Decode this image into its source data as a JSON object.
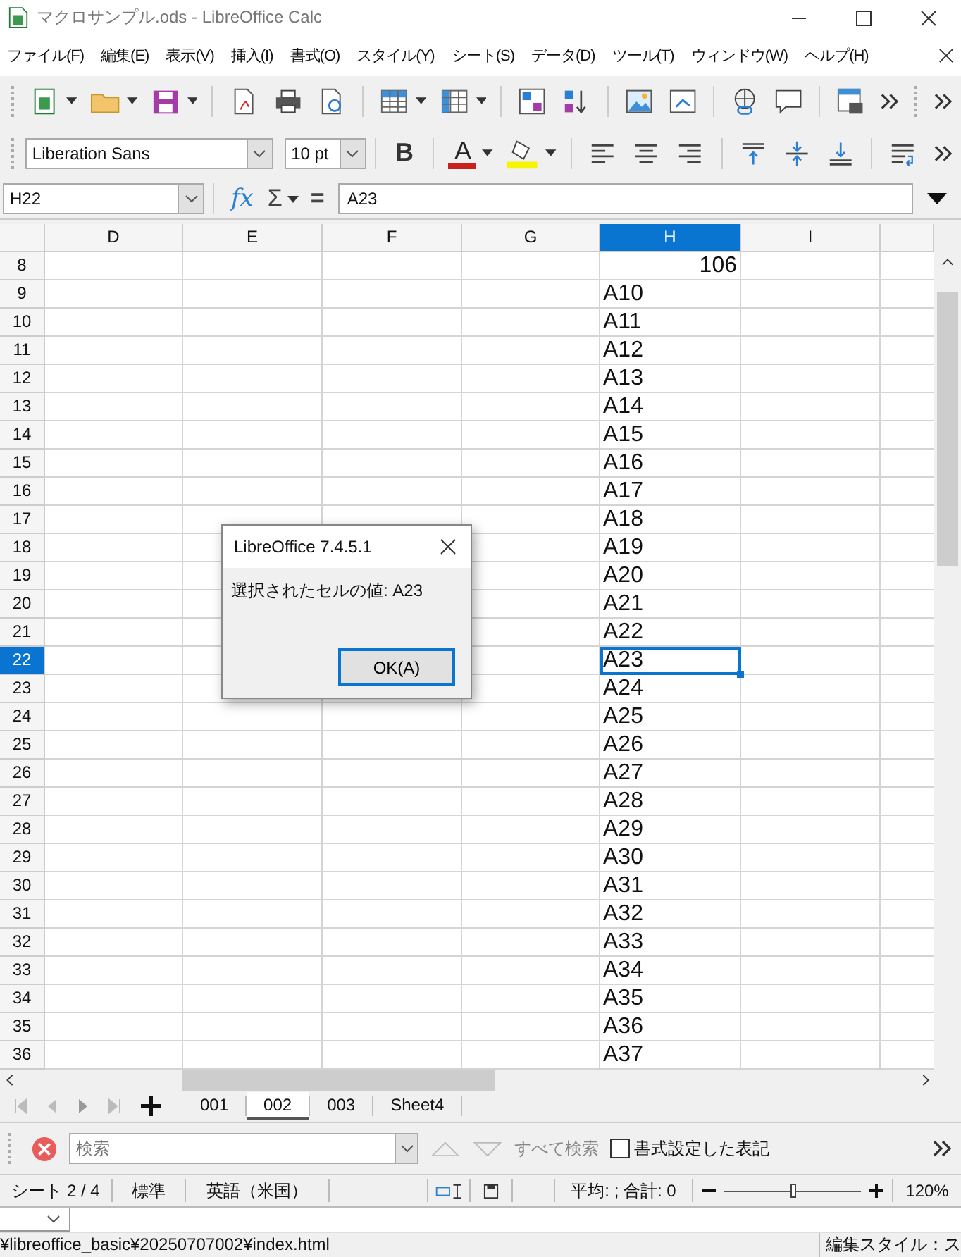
{
  "window": {
    "title": "マクロサンプル.ods - LibreOffice Calc"
  },
  "menu": [
    "ファイル(F)",
    "編集(E)",
    "表示(V)",
    "挿入(I)",
    "書式(O)",
    "スタイル(Y)",
    "シート(S)",
    "データ(D)",
    "ツール(T)",
    "ウィンドウ(W)",
    "ヘルプ(H)"
  ],
  "formatting": {
    "font_name": "Liberation Sans",
    "font_size": "10 pt",
    "bold_label": "B",
    "font_color_label": "A"
  },
  "formula_bar": {
    "name_box": "H22",
    "function_wizard": "fx",
    "sum": "Σ",
    "equals": "=",
    "formula": "A23"
  },
  "columns": [
    {
      "label": "D",
      "selected": false
    },
    {
      "label": "E",
      "selected": false
    },
    {
      "label": "F",
      "selected": false
    },
    {
      "label": "G",
      "selected": false
    },
    {
      "label": "H",
      "selected": true
    },
    {
      "label": "I",
      "selected": false
    }
  ],
  "rows": [
    {
      "number": "8",
      "selected": false,
      "kind": "number",
      "value": "106"
    },
    {
      "number": "9",
      "selected": false,
      "kind": "text",
      "value": "A10"
    },
    {
      "number": "10",
      "selected": false,
      "kind": "text",
      "value": "A11"
    },
    {
      "number": "11",
      "selected": false,
      "kind": "text",
      "value": "A12"
    },
    {
      "number": "12",
      "selected": false,
      "kind": "text",
      "value": "A13"
    },
    {
      "number": "13",
      "selected": false,
      "kind": "text",
      "value": "A14"
    },
    {
      "number": "14",
      "selected": false,
      "kind": "text",
      "value": "A15"
    },
    {
      "number": "15",
      "selected": false,
      "kind": "text",
      "value": "A16"
    },
    {
      "number": "16",
      "selected": false,
      "kind": "text",
      "value": "A17"
    },
    {
      "number": "17",
      "selected": false,
      "kind": "text",
      "value": "A18"
    },
    {
      "number": "18",
      "selected": false,
      "kind": "text",
      "value": "A19"
    },
    {
      "number": "19",
      "selected": false,
      "kind": "text",
      "value": "A20"
    },
    {
      "number": "20",
      "selected": false,
      "kind": "text",
      "value": "A21"
    },
    {
      "number": "21",
      "selected": false,
      "kind": "text",
      "value": "A22"
    },
    {
      "number": "22",
      "selected": true,
      "kind": "text",
      "value": "A23"
    },
    {
      "number": "23",
      "selected": false,
      "kind": "text",
      "value": "A24"
    },
    {
      "number": "24",
      "selected": false,
      "kind": "text",
      "value": "A25"
    },
    {
      "number": "25",
      "selected": false,
      "kind": "text",
      "value": "A26"
    },
    {
      "number": "26",
      "selected": false,
      "kind": "text",
      "value": "A27"
    },
    {
      "number": "27",
      "selected": false,
      "kind": "text",
      "value": "A28"
    },
    {
      "number": "28",
      "selected": false,
      "kind": "text",
      "value": "A29"
    },
    {
      "number": "29",
      "selected": false,
      "kind": "text",
      "value": "A30"
    },
    {
      "number": "30",
      "selected": false,
      "kind": "text",
      "value": "A31"
    },
    {
      "number": "31",
      "selected": false,
      "kind": "text",
      "value": "A32"
    },
    {
      "number": "32",
      "selected": false,
      "kind": "text",
      "value": "A33"
    },
    {
      "number": "33",
      "selected": false,
      "kind": "text",
      "value": "A34"
    },
    {
      "number": "34",
      "selected": false,
      "kind": "text",
      "value": "A35"
    },
    {
      "number": "35",
      "selected": false,
      "kind": "text",
      "value": "A36"
    },
    {
      "number": "36",
      "selected": false,
      "kind": "text",
      "value": "A37"
    }
  ],
  "dialog": {
    "title": "LibreOffice 7.4.5.1",
    "message": "選択されたセルの値: A23",
    "button": "OK(A)"
  },
  "sheet_tabs": [
    {
      "label": "001",
      "selected": false
    },
    {
      "label": "002",
      "selected": true
    },
    {
      "label": "003",
      "selected": false
    },
    {
      "label": "Sheet4",
      "selected": false
    }
  ],
  "find_bar": {
    "placeholder": "検索",
    "find_all": "すべて検索",
    "formatted_display": {
      "label": "書式設定した表記",
      "checked": false
    }
  },
  "status_bar": {
    "sheet": "シート 2 / 4",
    "page_style": "標準",
    "language": "英語（米国）",
    "summary": "平均: ; 合計: 0",
    "zoom_slider": {
      "level": 0.5
    },
    "zoom": "120%"
  },
  "background_window": {
    "path": "¥libreoffice_basic¥20250707002¥index.html",
    "status": "編集スタイル：ス"
  }
}
